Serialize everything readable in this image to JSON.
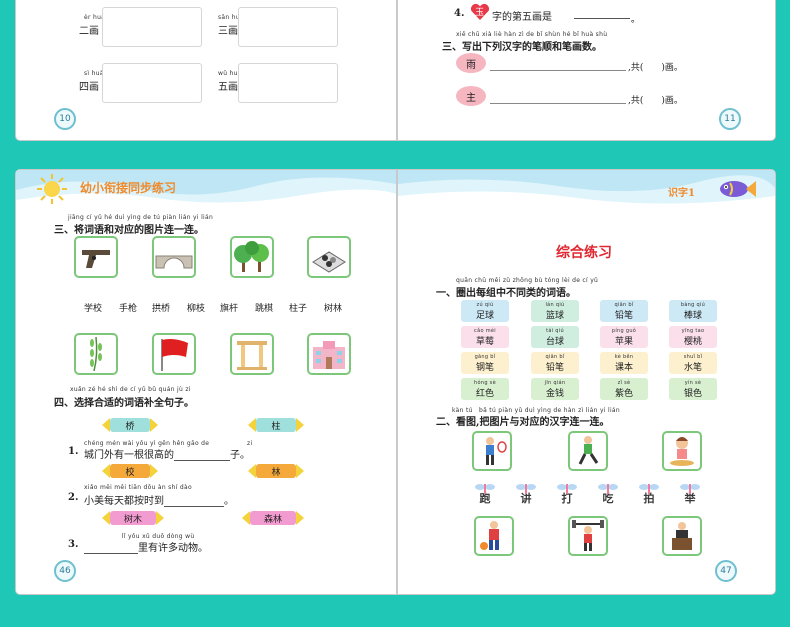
{
  "top": {
    "left_page": {
      "rows": [
        {
          "pinyin": "èr huà",
          "label": "二画"
        },
        {
          "pinyin": "sān huà",
          "label": "三画"
        },
        {
          "pinyin": "sì huà",
          "label": "四画"
        },
        {
          "pinyin": "wǔ huà",
          "label": "五画"
        }
      ],
      "page_number": "10"
    },
    "right_page": {
      "q4_num": "4.",
      "q4_badge": "玉",
      "q4_text": "字的第五画是",
      "sec3_pinyin": "xiě chū xià liè hàn zì de bǐ shùn hé bǐ huà shù",
      "sec3_title": "三、写出下列汉字的笔顺和笔画数。",
      "chars": [
        {
          "char": "雨",
          "tail": ",共(　　)画。"
        },
        {
          "char": "主",
          "tail": ",共(　　)画。"
        }
      ],
      "page_number": "11"
    }
  },
  "bottom": {
    "left_page": {
      "header_title": "幼小衔接同步练习",
      "sec3_pinyin": "jiāng cí yǔ hé duì yìng de tú piàn lián yi lián",
      "sec3_title": "三、将词语和对应的图片连一连。",
      "words": [
        "学校",
        "手枪",
        "拱桥",
        "柳枝",
        "旗杆",
        "跳棋",
        "柱子",
        "树林"
      ],
      "sec4_pinyin": "xuǎn zé hé shì de cí yǔ bǔ quán jù zi",
      "sec4_title": "四、选择合适的词语补全句子。",
      "candies": [
        {
          "text": "桥",
          "color": "#9fe0dc"
        },
        {
          "text": "柱",
          "color": "#9fe0dc"
        },
        {
          "text": "校",
          "color": "#f4a93a"
        },
        {
          "text": "林",
          "color": "#f4a93a"
        },
        {
          "text": "树木",
          "color": "#f29bd0"
        },
        {
          "text": "森林",
          "color": "#f29bd0"
        }
      ],
      "sentences": [
        {
          "num": "1.",
          "pinyin": "chéng mén wài yǒu yì gēn hěn gāo de　　　　　　zi",
          "before": "城门外有一根很高的",
          "after": "子。"
        },
        {
          "num": "2.",
          "pinyin": "xiǎo měi měi tiān dōu àn shí dào",
          "before": "小美每天都按时到",
          "after": "。"
        },
        {
          "num": "3.",
          "pinyin": "　　　　　　lǐ yǒu xǔ duō dòng wù",
          "before": "",
          "after": "里有许多动物。"
        }
      ],
      "page_number": "46"
    },
    "right_page": {
      "header_tag": "识字1",
      "main_title": "综合练习",
      "sec1_pinyin": "quān chū měi zǔ zhōng bù tóng lèi de cí yǔ",
      "sec1_title": "一、圈出每组中不同类的词语。",
      "tiles": [
        {
          "pinyin": "zú qiú",
          "word": "足球",
          "color": "#cde9f5"
        },
        {
          "pinyin": "lán qiú",
          "word": "篮球",
          "color": "#cfeee0"
        },
        {
          "pinyin": "qiān bǐ",
          "word": "铅笔",
          "color": "#cde9f5"
        },
        {
          "pinyin": "bàng qiú",
          "word": "棒球",
          "color": "#cde9f5"
        },
        {
          "pinyin": "cǎo méi",
          "word": "草莓",
          "color": "#fbe0ec"
        },
        {
          "pinyin": "tái qiú",
          "word": "台球",
          "color": "#cfeee0"
        },
        {
          "pinyin": "píng guǒ",
          "word": "苹果",
          "color": "#fbe0ec"
        },
        {
          "pinyin": "yīng tao",
          "word": "樱桃",
          "color": "#fbe0ec"
        },
        {
          "pinyin": "gāng bǐ",
          "word": "钢笔",
          "color": "#fdf0cf"
        },
        {
          "pinyin": "qiān bǐ",
          "word": "铅笔",
          "color": "#fdf0cf"
        },
        {
          "pinyin": "kè běn",
          "word": "课本",
          "color": "#fdf0cf"
        },
        {
          "pinyin": "shuǐ bǐ",
          "word": "水笔",
          "color": "#fdf0cf"
        },
        {
          "pinyin": "hóng sè",
          "word": "红色",
          "color": "#d8f0d0"
        },
        {
          "pinyin": "jīn qián",
          "word": "金钱",
          "color": "#d8f0d0"
        },
        {
          "pinyin": "zǐ sè",
          "word": "紫色",
          "color": "#d8f0d0"
        },
        {
          "pinyin": "yín sè",
          "word": "银色",
          "color": "#d8f0d0"
        }
      ],
      "sec2_pinyin": "kàn tú　bǎ tú piàn yǔ duì yìng de hàn zì lián yi lián",
      "sec2_title": "二、看图,把图片与对应的汉字连一连。",
      "bug_chars": [
        "跑",
        "讲",
        "打",
        "吃",
        "拍",
        "举"
      ],
      "page_number": "47"
    }
  }
}
